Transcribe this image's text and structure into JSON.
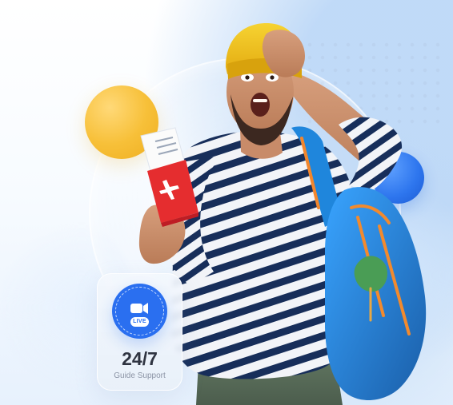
{
  "support_card": {
    "badge_label": "LIVE",
    "headline": "24/7",
    "caption": "Guide Support"
  },
  "icons": {
    "video": "video-camera-icon",
    "airplane": "airplane-icon"
  },
  "colors": {
    "background": "#F4F9FF",
    "accent_yellow": "#F7C039",
    "accent_blue": "#2E76EE",
    "passport_red": "#E52D2F",
    "beanie_yellow": "#F2C318",
    "shirt_navy": "#172E5A",
    "backpack_blue": "#1E7FD3",
    "support_card": "#EEF3FA"
  }
}
